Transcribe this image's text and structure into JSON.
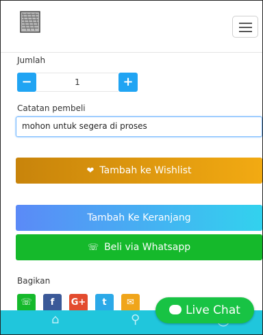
{
  "qty": {
    "label": "Jumlah",
    "minus": "−",
    "value": "1",
    "plus": "+"
  },
  "note": {
    "label": "Catatan pembeli",
    "value": "mohon untuk segera di proses"
  },
  "buttons": {
    "wishlist": "Tambah ke Wishlist",
    "cart": "Tambah Ke Keranjang",
    "whatsapp": "Beli via Whatsapp"
  },
  "share": {
    "label": "Bagikan",
    "facebook": "f",
    "google": "G+",
    "twitter": "t"
  },
  "chat": {
    "label": "Live Chat"
  },
  "colors": {
    "accent": "#20a4f3",
    "wishlist": "#e79a10",
    "whatsapp": "#15b92b",
    "bottom_bar": "#20c6dc",
    "live_chat": "#18c344"
  }
}
